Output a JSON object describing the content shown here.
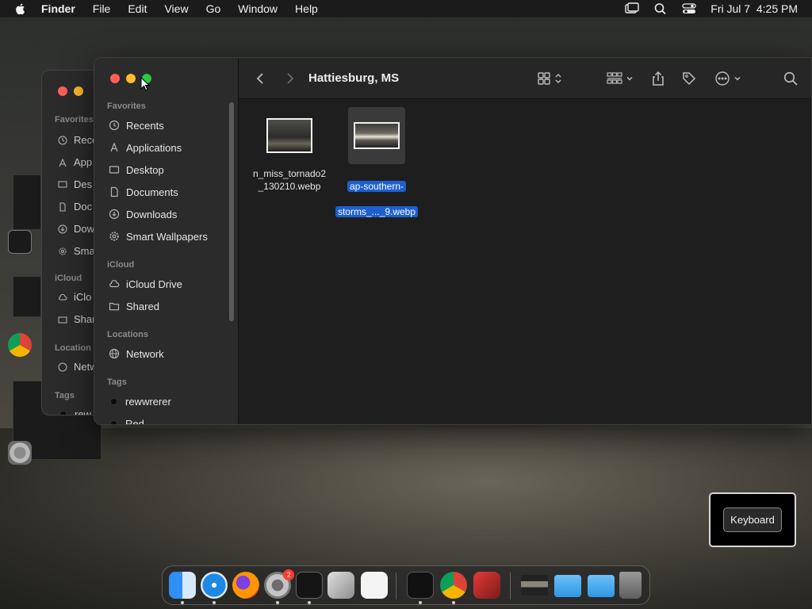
{
  "menubar": {
    "app": "Finder",
    "items": [
      "File",
      "Edit",
      "View",
      "Go",
      "Window",
      "Help"
    ],
    "datetime": "Fri Jul 7  4:25 PM"
  },
  "back_window": {
    "favorites_title": "Favorites",
    "items": [
      "Rece",
      "App",
      "Des",
      "Doc",
      "Dow",
      "Sma"
    ],
    "icloud_title": "iCloud",
    "icloud_items": [
      "iClo",
      "Shar"
    ],
    "locations_title": "Location",
    "locations_items": [
      "Netw"
    ],
    "tags_title": "Tags",
    "tag_items": [
      "rew"
    ]
  },
  "finder": {
    "title": "Hattiesburg, MS",
    "sidebar": {
      "favorites_title": "Favorites",
      "favorites": [
        {
          "label": "Recents",
          "icon": "clock-icon"
        },
        {
          "label": "Applications",
          "icon": "applications-icon"
        },
        {
          "label": "Desktop",
          "icon": "desktop-icon"
        },
        {
          "label": "Documents",
          "icon": "document-icon"
        },
        {
          "label": "Downloads",
          "icon": "download-icon"
        },
        {
          "label": "Smart Wallpapers",
          "icon": "gear-icon"
        }
      ],
      "icloud_title": "iCloud",
      "icloud": [
        {
          "label": "iCloud Drive",
          "icon": "cloud-icon"
        },
        {
          "label": "Shared",
          "icon": "shared-folder-icon"
        }
      ],
      "locations_title": "Locations",
      "locations": [
        {
          "label": "Network",
          "icon": "globe-icon"
        }
      ],
      "tags_title": "Tags",
      "tags": [
        {
          "label": "rewwrerer",
          "color": "#0d0d0d"
        },
        {
          "label": "Red",
          "color": "#0d0d0d"
        }
      ]
    },
    "files": [
      {
        "name": "n_miss_tornado2\n_130210.webp",
        "selected": false
      },
      {
        "name_line1": "ap-southern-",
        "name_line2": "storms_..._9.webp",
        "selected": true
      }
    ]
  },
  "keyboard_widget": {
    "label": "Keyboard"
  },
  "dock": {
    "apps": [
      "finder",
      "safari",
      "firefox",
      "system-settings",
      "terminal",
      "script-editor",
      "vscode",
      "activity-monitor",
      "chrome",
      "rocket-typist",
      "image-viewer",
      "folder",
      "folder",
      "trash"
    ],
    "settings_badge": "2"
  },
  "colors": {
    "selection": "#1d5fd0",
    "sidebar_bg": "#2b2b2b",
    "content_bg": "#1e1e1e"
  }
}
